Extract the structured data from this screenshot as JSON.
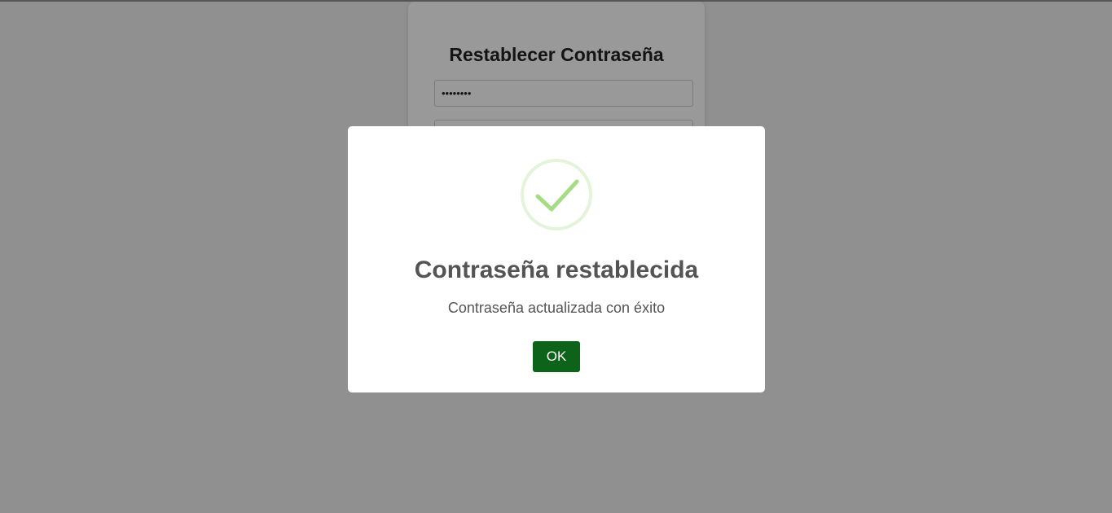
{
  "form": {
    "title": "Restablecer Contraseña",
    "password_value": "••••••••",
    "confirm_value": ""
  },
  "dialog": {
    "icon": "checkmark-success-icon",
    "title": "Contraseña restablecida",
    "message": "Contraseña actualizada con éxito",
    "ok_label": "OK"
  },
  "colors": {
    "ok_button": "#0c6319",
    "success_icon": "#a5dc86",
    "overlay": "rgba(0,0,0,0.4)"
  }
}
